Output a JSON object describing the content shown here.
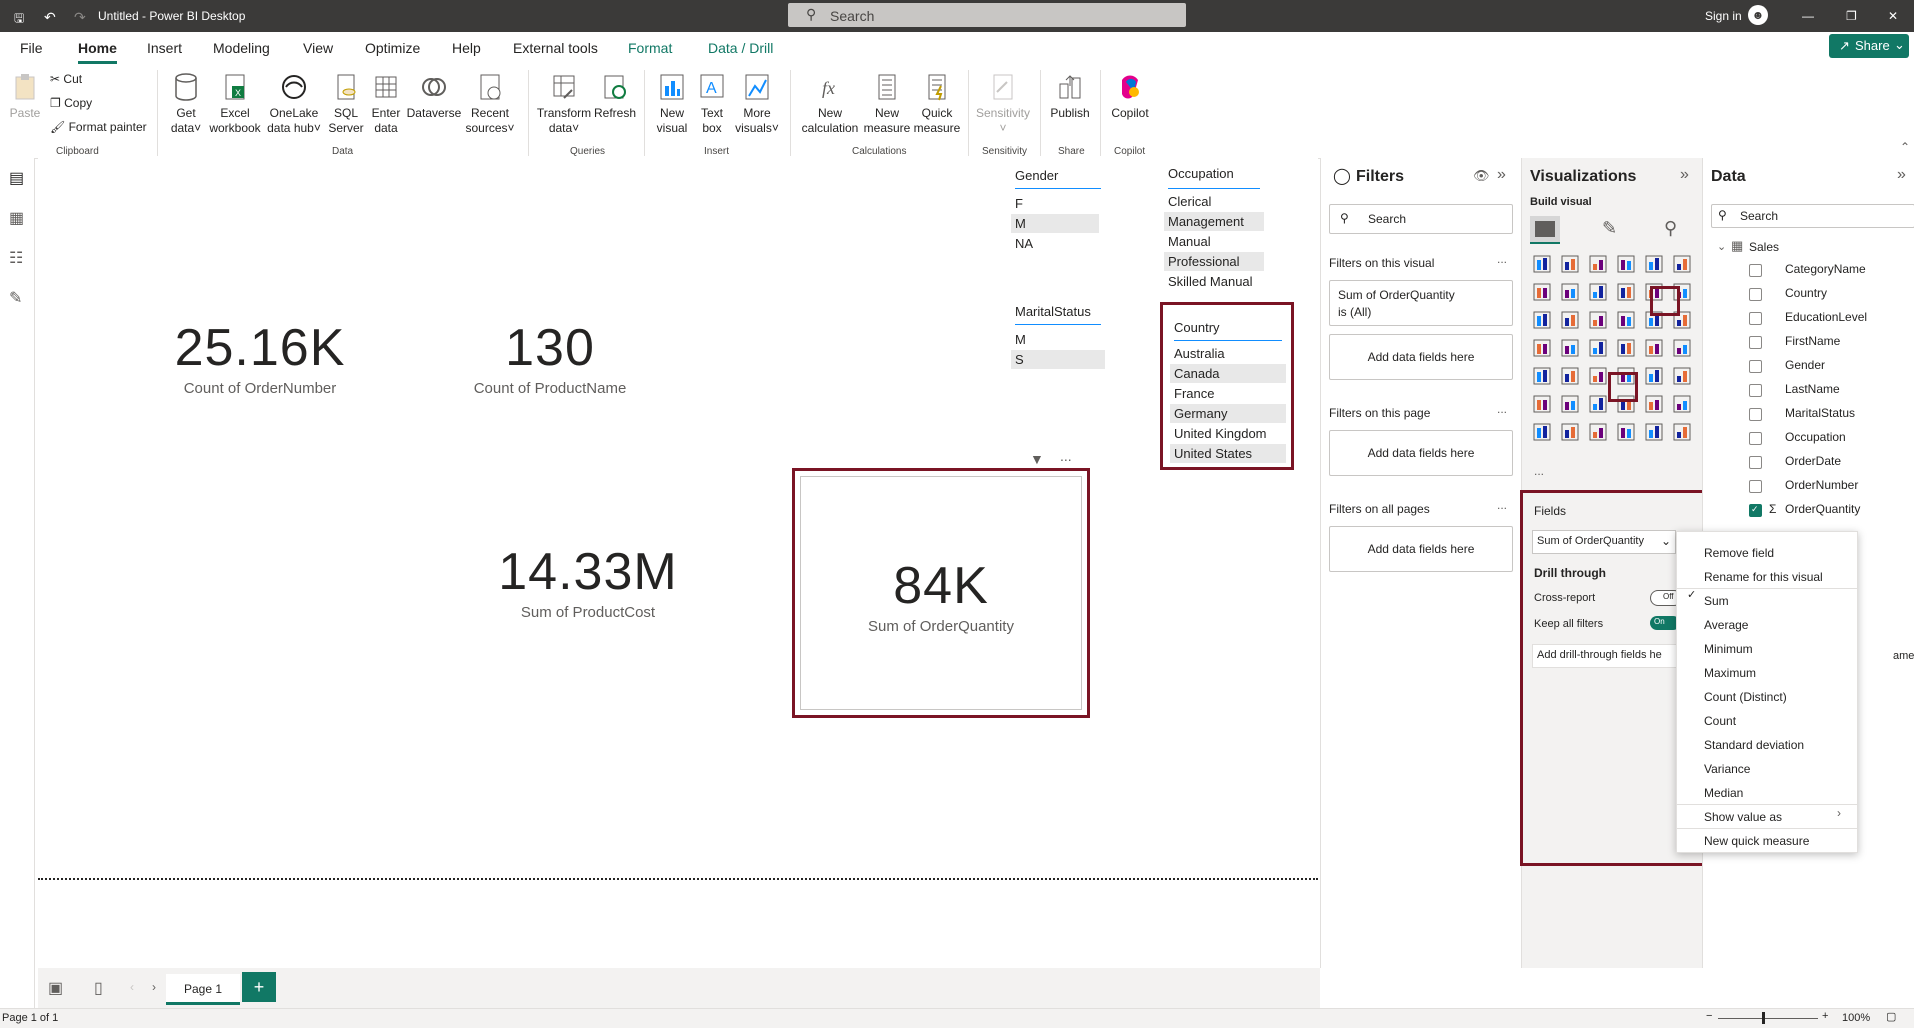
{
  "title_bar": {
    "title": "Untitled - Power BI Desktop",
    "search_placeholder": "Search",
    "sign_in": "Sign in"
  },
  "menu": {
    "tabs": [
      "File",
      "Home",
      "Insert",
      "Modeling",
      "View",
      "Optimize",
      "Help",
      "External tools",
      "Format",
      "Data / Drill"
    ],
    "active": "Home",
    "share": "Share"
  },
  "ribbon": {
    "clipboard": {
      "paste": "Paste",
      "cut": "Cut",
      "copy": "Copy",
      "format_painter": "Format painter",
      "group": "Clipboard"
    },
    "data": {
      "get_data": "Get data",
      "get_data_2": "data",
      "get_data_1": "Get",
      "excel_1": "Excel",
      "excel_2": "workbook",
      "onelake_1": "OneLake",
      "onelake_2": "data hub",
      "sql_1": "SQL",
      "sql_2": "Server",
      "enter_1": "Enter",
      "enter_2": "data",
      "dataverse": "Dataverse",
      "recent_1": "Recent",
      "recent_2": "sources",
      "group": "Data"
    },
    "queries": {
      "transform_1": "Transform",
      "transform_2": "data",
      "refresh": "Refresh",
      "group": "Queries"
    },
    "insert": {
      "new_1": "New",
      "new_2": "visual",
      "text_1": "Text",
      "text_2": "box",
      "more_1": "More",
      "more_2": "visuals",
      "group": "Insert"
    },
    "calculations": {
      "calc_1": "New",
      "calc_2": "calculation",
      "measure_1": "New",
      "measure_2": "measure",
      "quick_1": "Quick",
      "quick_2": "measure",
      "group": "Calculations"
    },
    "sensitivity": {
      "label": "Sensitivity",
      "group": "Sensitivity"
    },
    "share": {
      "publish": "Publish",
      "group": "Share"
    },
    "copilot": {
      "label": "Copilot",
      "group": "Copilot"
    }
  },
  "canvas": {
    "kpis": [
      {
        "value": "25.16K",
        "label": "Count of OrderNumber"
      },
      {
        "value": "130",
        "label": "Count of ProductName"
      },
      {
        "value": "14.33M",
        "label": "Sum of ProductCost"
      },
      {
        "value": "84K",
        "label": "Sum of OrderQuantity"
      }
    ],
    "gender": {
      "title": "Gender",
      "items": [
        "F",
        "M",
        "NA"
      ]
    },
    "marital": {
      "title": "MaritalStatus",
      "items": [
        "M",
        "S"
      ]
    },
    "occupation": {
      "title": "Occupation",
      "items": [
        "Clerical",
        "Management",
        "Manual",
        "Professional",
        "Skilled Manual"
      ]
    },
    "country": {
      "title": "Country",
      "items": [
        "Australia",
        "Canada",
        "France",
        "Germany",
        "United Kingdom",
        "United States"
      ]
    },
    "more": "..."
  },
  "filters": {
    "title": "Filters",
    "search": "Search",
    "on_visual": "Filters on this visual",
    "visual_filter_1": "Sum of OrderQuantity",
    "visual_filter_2": "is (All)",
    "add": "Add data fields here",
    "on_page": "Filters on this page",
    "on_all": "Filters on all pages"
  },
  "viz": {
    "title": "Visualizations",
    "build": "Build visual",
    "fields": "Fields",
    "field_value": "Sum of OrderQuantity",
    "drill": "Drill through",
    "cross": "Cross-report",
    "cross_state": "Off",
    "keep": "Keep all filters",
    "keep_state": "On",
    "add_drill": "Add drill-through fields he",
    "more": "..."
  },
  "data_pane": {
    "title": "Data",
    "search": "Search",
    "table": "Sales",
    "fields": [
      "CategoryName",
      "Country",
      "EducationLevel",
      "FirstName",
      "Gender",
      "LastName",
      "MaritalStatus",
      "Occupation",
      "OrderDate",
      "OrderNumber",
      "OrderQuantity"
    ],
    "cut_text": "ame"
  },
  "context_menu": {
    "items": [
      "Remove field",
      "Rename for this visual",
      "Sum",
      "Average",
      "Minimum",
      "Maximum",
      "Count (Distinct)",
      "Count",
      "Standard deviation",
      "Variance",
      "Median",
      "Show value as",
      "New quick measure"
    ],
    "checked": "Sum"
  },
  "pages": {
    "tab": "Page 1",
    "status": "Page 1 of 1",
    "zoom": "100%"
  },
  "colors": {
    "accent": "#117865",
    "highlight": "#7a1424",
    "titlebar": "#3b3a39"
  }
}
